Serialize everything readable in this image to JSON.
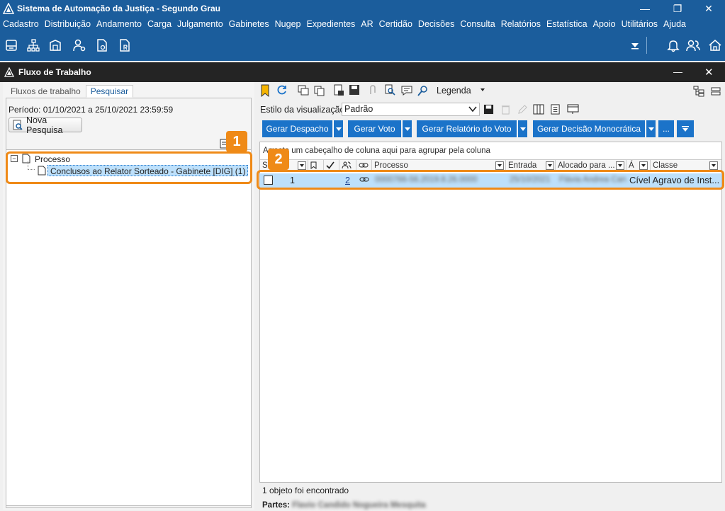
{
  "window": {
    "title": "Sistema de Automação da Justiça - Segundo Grau",
    "minimize": "—",
    "restore": "❐",
    "close": "✕"
  },
  "menu": [
    "Cadastro",
    "Distribuição",
    "Andamento",
    "Carga",
    "Julgamento",
    "Gabinetes",
    "Nugep",
    "Expedientes",
    "AR",
    "Certidão",
    "Decisões",
    "Consulta",
    "Relatórios",
    "Estatística",
    "Apoio",
    "Utilitários",
    "Ajuda"
  ],
  "module": {
    "title": "Fluxo de Trabalho",
    "minimize": "—",
    "close": "✕"
  },
  "left": {
    "tabs": [
      "Fluxos de trabalho",
      "Pesquisar"
    ],
    "active_tab": "Pesquisar",
    "period": "Período: 01/10/2021 a 25/10/2021 23:59:59",
    "new_search": "Nova Pesquisa",
    "tree": {
      "root": "Processo",
      "child": "Conclusos ao Relator Sorteado - Gabinete [DIG] (1)",
      "expander": "−"
    },
    "badge": "1"
  },
  "right": {
    "legend": "Legenda",
    "view_style_label": "Estilo da visualização",
    "view_style_value": "Padrão",
    "buttons": [
      "Gerar Despacho",
      "Gerar Voto",
      "Gerar Relatório do Voto",
      "Gerar Decisão Monocrática"
    ],
    "more": "...",
    "group_hint": "Arraste um cabeçalho de coluna aqui para agrupar pela coluna",
    "columns": {
      "s": "S",
      "n": "",
      "processo": "Processo",
      "entrada": "Entrada",
      "alocado": "Alocado para ...",
      "a": "Á",
      "classe": "Classe"
    },
    "row": {
      "num": "1",
      "count": "2",
      "processo": "0000766-56.2019.8.26.0000",
      "entrada": "25/10/2021",
      "alocado": "Flávia Andrea Carvalho",
      "classe": "Cível Agravo de Inst..."
    },
    "badge": "2",
    "status": "1 objeto foi encontrado",
    "partes_label": "Partes:",
    "partes_value": "Flavio Candido Nogueira Mesquita"
  },
  "colors": {
    "brand": "#1b5d9c",
    "button_blue": "#1b73c9",
    "highlight": "#ef8a17",
    "selected_row": "#bde0fb"
  }
}
